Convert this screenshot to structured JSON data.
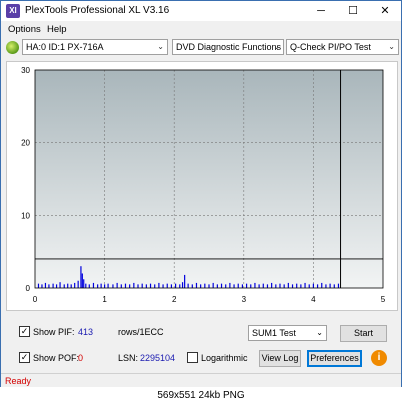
{
  "window": {
    "title": "PlexTools Professional XL V3.16",
    "minimize_glyph": "─",
    "maximize_glyph": "☐",
    "close_glyph": "✕",
    "app_icon_text": "Xl"
  },
  "menu": {
    "options": "Options",
    "help": "Help"
  },
  "toolbar": {
    "drive": "HA:0 ID:1  PX-716A",
    "function": "DVD Diagnostic Functions",
    "test": "Q-Check PI/PO Test",
    "arrow": "⌄"
  },
  "chart_data": {
    "type": "bar",
    "x_ticks": [
      "0",
      "1",
      "2",
      "3",
      "4",
      "5"
    ],
    "y_ticks": [
      "0",
      "10",
      "20",
      "30"
    ],
    "xlim": [
      0,
      5
    ],
    "ylim": [
      0,
      30
    ],
    "grid": "dashed",
    "threshold_line_y": 4,
    "end_marker_x": 4.39,
    "colors": {
      "bars": "#0000dd",
      "axis": "#000000",
      "plot_top": "#a9b6bb",
      "plot_bottom": "#f2f4f4"
    },
    "pi_bars": [
      {
        "x": 0.05,
        "y": 0.6
      },
      {
        "x": 0.1,
        "y": 0.5
      },
      {
        "x": 0.15,
        "y": 0.7
      },
      {
        "x": 0.2,
        "y": 0.5
      },
      {
        "x": 0.26,
        "y": 0.6
      },
      {
        "x": 0.31,
        "y": 0.5
      },
      {
        "x": 0.36,
        "y": 0.8
      },
      {
        "x": 0.42,
        "y": 0.5
      },
      {
        "x": 0.47,
        "y": 0.6
      },
      {
        "x": 0.52,
        "y": 0.5
      },
      {
        "x": 0.57,
        "y": 0.7
      },
      {
        "x": 0.62,
        "y": 1.0
      },
      {
        "x": 0.66,
        "y": 3.0
      },
      {
        "x": 0.68,
        "y": 2.0
      },
      {
        "x": 0.7,
        "y": 1.2
      },
      {
        "x": 0.73,
        "y": 0.6
      },
      {
        "x": 0.78,
        "y": 0.5
      },
      {
        "x": 0.84,
        "y": 0.7
      },
      {
        "x": 0.9,
        "y": 0.5
      },
      {
        "x": 0.95,
        "y": 0.6
      },
      {
        "x": 1.0,
        "y": 0.5
      },
      {
        "x": 1.05,
        "y": 0.6
      },
      {
        "x": 1.12,
        "y": 0.5
      },
      {
        "x": 1.18,
        "y": 0.7
      },
      {
        "x": 1.24,
        "y": 0.5
      },
      {
        "x": 1.3,
        "y": 0.6
      },
      {
        "x": 1.36,
        "y": 0.5
      },
      {
        "x": 1.42,
        "y": 0.7
      },
      {
        "x": 1.48,
        "y": 0.5
      },
      {
        "x": 1.54,
        "y": 0.6
      },
      {
        "x": 1.6,
        "y": 0.5
      },
      {
        "x": 1.66,
        "y": 0.6
      },
      {
        "x": 1.72,
        "y": 0.5
      },
      {
        "x": 1.78,
        "y": 0.7
      },
      {
        "x": 1.84,
        "y": 0.5
      },
      {
        "x": 1.9,
        "y": 0.6
      },
      {
        "x": 1.96,
        "y": 0.5
      },
      {
        "x": 2.02,
        "y": 0.6
      },
      {
        "x": 2.08,
        "y": 0.5
      },
      {
        "x": 2.12,
        "y": 0.8
      },
      {
        "x": 2.15,
        "y": 1.8
      },
      {
        "x": 2.2,
        "y": 0.6
      },
      {
        "x": 2.26,
        "y": 0.5
      },
      {
        "x": 2.32,
        "y": 0.7
      },
      {
        "x": 2.38,
        "y": 0.5
      },
      {
        "x": 2.44,
        "y": 0.6
      },
      {
        "x": 2.5,
        "y": 0.5
      },
      {
        "x": 2.56,
        "y": 0.7
      },
      {
        "x": 2.62,
        "y": 0.5
      },
      {
        "x": 2.68,
        "y": 0.6
      },
      {
        "x": 2.74,
        "y": 0.5
      },
      {
        "x": 2.8,
        "y": 0.7
      },
      {
        "x": 2.86,
        "y": 0.5
      },
      {
        "x": 2.92,
        "y": 0.6
      },
      {
        "x": 2.98,
        "y": 0.5
      },
      {
        "x": 3.04,
        "y": 0.6
      },
      {
        "x": 3.1,
        "y": 0.5
      },
      {
        "x": 3.16,
        "y": 0.7
      },
      {
        "x": 3.22,
        "y": 0.5
      },
      {
        "x": 3.28,
        "y": 0.6
      },
      {
        "x": 3.34,
        "y": 0.5
      },
      {
        "x": 3.4,
        "y": 0.7
      },
      {
        "x": 3.46,
        "y": 0.5
      },
      {
        "x": 3.52,
        "y": 0.6
      },
      {
        "x": 3.58,
        "y": 0.5
      },
      {
        "x": 3.64,
        "y": 0.7
      },
      {
        "x": 3.7,
        "y": 0.5
      },
      {
        "x": 3.76,
        "y": 0.6
      },
      {
        "x": 3.82,
        "y": 0.5
      },
      {
        "x": 3.88,
        "y": 0.7
      },
      {
        "x": 3.94,
        "y": 0.5
      },
      {
        "x": 4.0,
        "y": 0.6
      },
      {
        "x": 4.06,
        "y": 0.5
      },
      {
        "x": 4.12,
        "y": 0.7
      },
      {
        "x": 4.18,
        "y": 0.5
      },
      {
        "x": 4.24,
        "y": 0.6
      },
      {
        "x": 4.3,
        "y": 0.5
      },
      {
        "x": 4.36,
        "y": 0.6
      }
    ]
  },
  "controls": {
    "show_pif_label": "Show PIF:",
    "pif_value": "413",
    "pif_unit": "rows/1ECC",
    "show_pof_label": "Show POF:",
    "pof_value": "0",
    "lsn_label": "LSN:",
    "lsn_value": "2295104",
    "logarithmic_label": "Logarithmic",
    "sum_combo": "SUM1 Test",
    "start_button": "Start",
    "view_log_button": "View Log",
    "preferences_button": "Preferences",
    "info_glyph": "i",
    "checkmark": "✓",
    "show_pif_checked": true,
    "show_pof_checked": true,
    "logarithmic_checked": false
  },
  "status": {
    "text": "Ready"
  },
  "caption": {
    "text": "569x551  24kb  PNG"
  }
}
